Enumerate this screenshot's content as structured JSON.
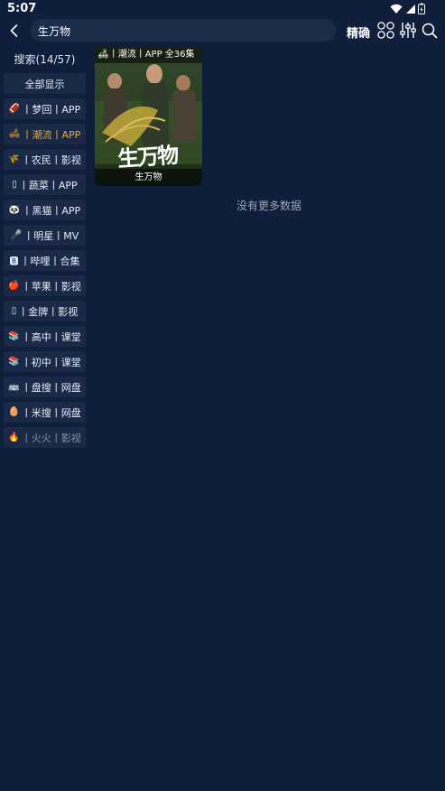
{
  "status_bar": {
    "time": "5:07"
  },
  "topbar": {
    "back_icon": "chevron-left-icon",
    "search_value": "生万物",
    "exact_label": "精确",
    "grid_icon": "grid-icon",
    "filter_icon": "sliders-icon",
    "search_icon": "search-icon"
  },
  "sidebar": {
    "title": "搜索(14/57)",
    "show_all": "全部显示",
    "items": [
      {
        "icon": "🏈",
        "label": "丨梦回丨APP",
        "state": "normal"
      },
      {
        "icon": "🛋",
        "label": "丨潮流丨APP",
        "state": "active"
      },
      {
        "icon": "🌾",
        "label": "丨农民丨影视",
        "state": "normal"
      },
      {
        "icon": "▯",
        "label": "丨蔬菜丨APP",
        "state": "normal"
      },
      {
        "icon": "🐼",
        "label": "丨黑猫丨APP",
        "state": "normal"
      },
      {
        "icon": "🎤",
        "label": "丨明星丨MV",
        "state": "normal"
      },
      {
        "icon": "🅱",
        "label": "丨哔哩丨合集",
        "state": "normal"
      },
      {
        "icon": "🍎",
        "label": "丨苹果丨影视",
        "state": "normal"
      },
      {
        "icon": "▯",
        "label": "丨金牌丨影视",
        "state": "normal"
      },
      {
        "icon": "📚",
        "label": "丨高中丨课堂",
        "state": "normal"
      },
      {
        "icon": "📚",
        "label": "丨初中丨课堂",
        "state": "normal"
      },
      {
        "icon": "🚌",
        "label": "丨盘搜丨网盘",
        "state": "normal"
      },
      {
        "icon": "🥚",
        "label": "丨米搜丨网盘",
        "state": "normal"
      },
      {
        "icon": "🔥",
        "label": "丨火火丨影视",
        "state": "dim"
      }
    ]
  },
  "results": [
    {
      "tag_icon": "🛋",
      "tag": "丨潮流丨APP 全36集",
      "title": "生万物",
      "poster_text": "生万物"
    }
  ],
  "footer_text": "没有更多数据"
}
